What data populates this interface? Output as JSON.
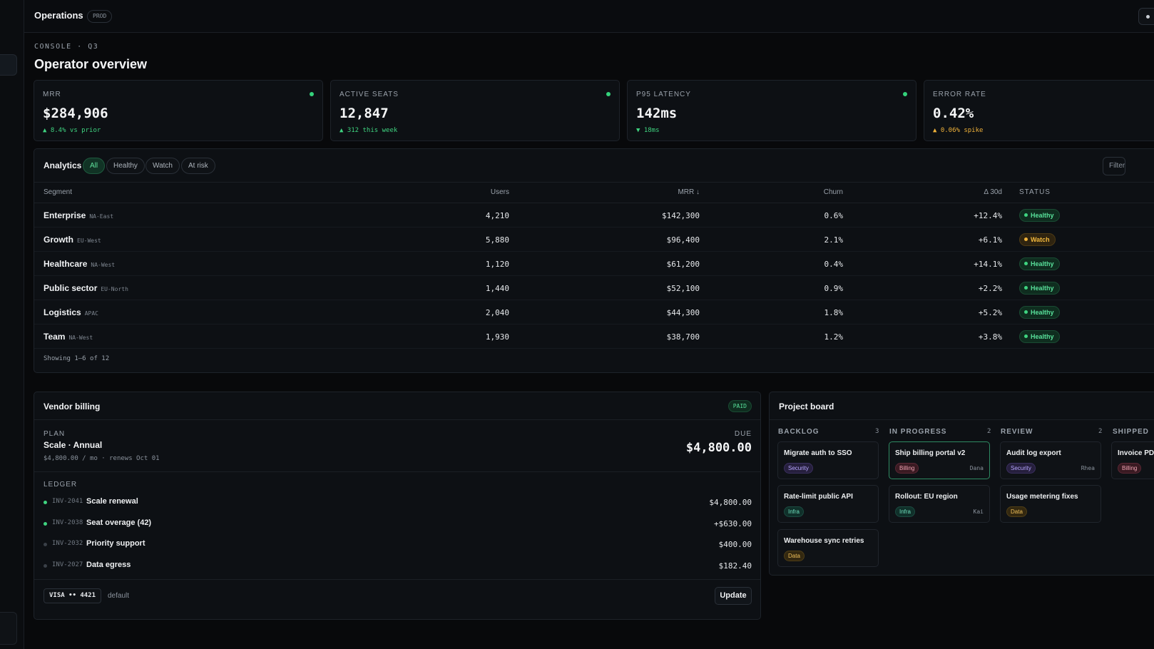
{
  "app": {
    "title": "Operations",
    "env": "PROD"
  },
  "page": {
    "eyebrow": "CONSOLE · Q3",
    "title": "Operator overview"
  },
  "kpis": [
    {
      "label": "MRR",
      "value": "$284,906",
      "delta": "▲ 8.4% vs prior"
    },
    {
      "label": "ACTIVE SEATS",
      "value": "12,847",
      "delta": "▲ 312 this week"
    },
    {
      "label": "P95 LATENCY",
      "value": "142ms",
      "delta": "▼ 18ms"
    },
    {
      "label": "ERROR RATE",
      "value": "0.42%",
      "delta": "▲ 0.06% spike"
    }
  ],
  "analytics": {
    "title": "Analytics",
    "filters": [
      "All",
      "Healthy",
      "Watch",
      "At risk"
    ],
    "filter_button": "Filter",
    "columns": [
      "Segment",
      "Users",
      "MRR ↓",
      "Churn",
      "Δ 30d",
      "STATUS"
    ],
    "rows": [
      {
        "segment": "Enterprise",
        "region": "NA-East",
        "users": "4,210",
        "mrr": "$142,300",
        "churn": "0.6%",
        "delta": "+12.4%",
        "status": "Healthy"
      },
      {
        "segment": "Growth",
        "region": "EU-West",
        "users": "5,880",
        "mrr": "$96,400",
        "churn": "2.1%",
        "delta": "+6.1%",
        "status": "Watch"
      },
      {
        "segment": "Healthcare",
        "region": "NA-West",
        "users": "1,120",
        "mrr": "$61,200",
        "churn": "0.4%",
        "delta": "+14.1%",
        "status": "Healthy"
      },
      {
        "segment": "Public sector",
        "region": "EU-North",
        "users": "1,440",
        "mrr": "$52,100",
        "churn": "0.9%",
        "delta": "+2.2%",
        "status": "Healthy"
      },
      {
        "segment": "Logistics",
        "region": "APAC",
        "users": "2,040",
        "mrr": "$44,300",
        "churn": "1.8%",
        "delta": "+5.2%",
        "status": "Healthy"
      },
      {
        "segment": "Team",
        "region": "NA-West",
        "users": "1,930",
        "mrr": "$38,700",
        "churn": "1.2%",
        "delta": "+3.8%",
        "status": "Healthy"
      }
    ],
    "footnote": "Showing 1–6 of 12"
  },
  "billing": {
    "title": "Vendor billing",
    "badge": "PAID",
    "plan_label": "PLAN",
    "plan_name": "Scale · Annual",
    "plan_detail": "$4,800.00 / mo · renews Oct 01",
    "due_label": "DUE",
    "due_amount": "$4,800.00",
    "ledger_label": "LEDGER",
    "ledger": [
      {
        "inv": "INV-2041",
        "desc": "Scale renewal",
        "amount": "$4,800.00"
      },
      {
        "inv": "INV-2038",
        "desc": "Seat overage (42)",
        "amount": "+$630.00"
      },
      {
        "inv": "INV-2032",
        "desc": "Priority support",
        "amount": "$400.00"
      },
      {
        "inv": "INV-2027",
        "desc": "Data egress",
        "amount": "$182.40"
      }
    ],
    "card": "VISA •• 4421",
    "card_note": "default",
    "update_label": "Update"
  },
  "board": {
    "title": "Project board",
    "columns": [
      {
        "name": "BACKLOG",
        "count": "3",
        "tasks": [
          {
            "title": "Migrate auth to SSO",
            "tag": "Security",
            "who": ""
          },
          {
            "title": "Rate-limit public API",
            "tag": "Infra",
            "who": ""
          },
          {
            "title": "Warehouse sync retries",
            "tag": "Data",
            "who": ""
          }
        ]
      },
      {
        "name": "IN PROGRESS",
        "count": "2",
        "tasks": [
          {
            "title": "Ship billing portal v2",
            "tag": "Billing",
            "who": "Dana"
          },
          {
            "title": "Rollout: EU region",
            "tag": "Infra",
            "who": "Kai"
          }
        ]
      },
      {
        "name": "REVIEW",
        "count": "2",
        "tasks": [
          {
            "title": "Audit log export",
            "tag": "Security",
            "who": "Rhea"
          },
          {
            "title": "Usage metering fixes",
            "tag": "Data",
            "who": ""
          }
        ]
      },
      {
        "name": "SHIPPED",
        "count": "",
        "tasks": [
          {
            "title": "Invoice PDF",
            "tag": "Billing",
            "who": ""
          }
        ]
      }
    ]
  },
  "colors": {
    "accent_green": "#3fd480",
    "amber": "#f0b23a",
    "background": "#08090b",
    "card": "#0d1014"
  }
}
